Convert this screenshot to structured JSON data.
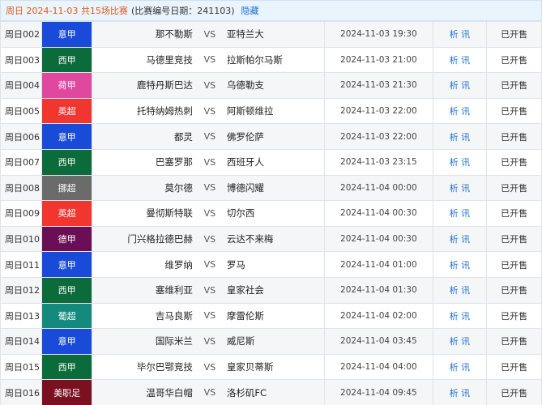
{
  "header": {
    "date_text": "周日 2024-11-03",
    "count_text": "共15场比赛",
    "meta_text": "(比赛编号日期：241103)",
    "hide_label": "隐藏"
  },
  "matches": [
    {
      "num": "周日002",
      "league": "意甲",
      "league_color": "#1a4bd8",
      "home": "那不勒斯",
      "vs": "VS",
      "away": "亚特兰大",
      "time": "2024-11-03 19:30",
      "link": "析 讯",
      "status": "已开售"
    },
    {
      "num": "周日003",
      "league": "西甲",
      "league_color": "#0b6b3a",
      "home": "马德里竞技",
      "vs": "VS",
      "away": "拉斯帕尔马斯",
      "time": "2024-11-03 21:00",
      "link": "析 讯",
      "status": "已开售"
    },
    {
      "num": "周日004",
      "league": "荷甲",
      "league_color": "#e0479e",
      "home": "鹿特丹斯巴达",
      "vs": "VS",
      "away": "乌德勒支",
      "time": "2024-11-03 21:30",
      "link": "析 讯",
      "status": "已开售"
    },
    {
      "num": "周日005",
      "league": "英超",
      "league_color": "#f0362e",
      "home": "托特纳姆热刺",
      "vs": "VS",
      "away": "阿斯顿维拉",
      "time": "2024-11-03 22:00",
      "link": "析 讯",
      "status": "已开售"
    },
    {
      "num": "周日006",
      "league": "意甲",
      "league_color": "#1a4bd8",
      "home": "都灵",
      "vs": "VS",
      "away": "佛罗伦萨",
      "time": "2024-11-03 22:00",
      "link": "析 讯",
      "status": "已开售"
    },
    {
      "num": "周日007",
      "league": "西甲",
      "league_color": "#0b6b3a",
      "home": "巴塞罗那",
      "vs": "VS",
      "away": "西班牙人",
      "time": "2024-11-03 23:15",
      "link": "析 讯",
      "status": "已开售"
    },
    {
      "num": "周日008",
      "league": "挪超",
      "league_color": "#6b6b6b",
      "home": "莫尔德",
      "vs": "VS",
      "away": "博德闪耀",
      "time": "2024-11-04 00:00",
      "link": "析 讯",
      "status": "已开售"
    },
    {
      "num": "周日009",
      "league": "英超",
      "league_color": "#f0362e",
      "home": "曼彻斯特联",
      "vs": "VS",
      "away": "切尔西",
      "time": "2024-11-04 00:30",
      "link": "析 讯",
      "status": "已开售"
    },
    {
      "num": "周日010",
      "league": "德甲",
      "league_color": "#6a0f55",
      "home": "门兴格拉德巴赫",
      "vs": "VS",
      "away": "云达不来梅",
      "time": "2024-11-04 00:30",
      "link": "析 讯",
      "status": "已开售"
    },
    {
      "num": "周日011",
      "league": "意甲",
      "league_color": "#1a4bd8",
      "home": "维罗纳",
      "vs": "VS",
      "away": "罗马",
      "time": "2024-11-04 01:00",
      "link": "析 讯",
      "status": "已开售"
    },
    {
      "num": "周日012",
      "league": "西甲",
      "league_color": "#0b6b3a",
      "home": "塞维利亚",
      "vs": "VS",
      "away": "皇家社会",
      "time": "2024-11-04 01:30",
      "link": "析 讯",
      "status": "已开售"
    },
    {
      "num": "周日013",
      "league": "葡超",
      "league_color": "#138a7d",
      "home": "吉马良斯",
      "vs": "VS",
      "away": "摩雷伦斯",
      "time": "2024-11-04 02:00",
      "link": "析 讯",
      "status": "已开售"
    },
    {
      "num": "周日014",
      "league": "意甲",
      "league_color": "#1a4bd8",
      "home": "国际米兰",
      "vs": "VS",
      "away": "威尼斯",
      "time": "2024-11-04 03:45",
      "link": "析 讯",
      "status": "已开售"
    },
    {
      "num": "周日015",
      "league": "西甲",
      "league_color": "#0b6b3a",
      "home": "毕尔巴鄂竞技",
      "vs": "VS",
      "away": "皇家贝蒂斯",
      "time": "2024-11-04 04:00",
      "link": "析 讯",
      "status": "已开售"
    },
    {
      "num": "周日016",
      "league": "美职足",
      "league_color": "#7a1020",
      "home": "温哥华白帽",
      "vs": "VS",
      "away": "洛杉矶FC",
      "time": "2024-11-04 09:45",
      "link": "析 讯",
      "status": "已开售"
    }
  ]
}
